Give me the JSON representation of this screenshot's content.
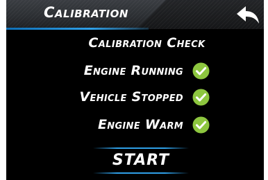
{
  "header": {
    "title": "Calibration",
    "back_icon": "back-arrow-icon"
  },
  "main": {
    "check_title": "Calibration Check",
    "conditions": [
      {
        "label": "Engine Running",
        "status": "checked",
        "icon": "check-circle-icon"
      },
      {
        "label": "Vehicle Stopped",
        "status": "checked",
        "icon": "check-circle-icon"
      },
      {
        "label": "Engine Warm",
        "status": "checked",
        "icon": "check-circle-icon"
      }
    ],
    "start_label": "START"
  },
  "colors": {
    "background": "#000000",
    "accent_blue": "#2fa0e8",
    "check_green": "#8dc63f",
    "text": "#ffffff"
  }
}
